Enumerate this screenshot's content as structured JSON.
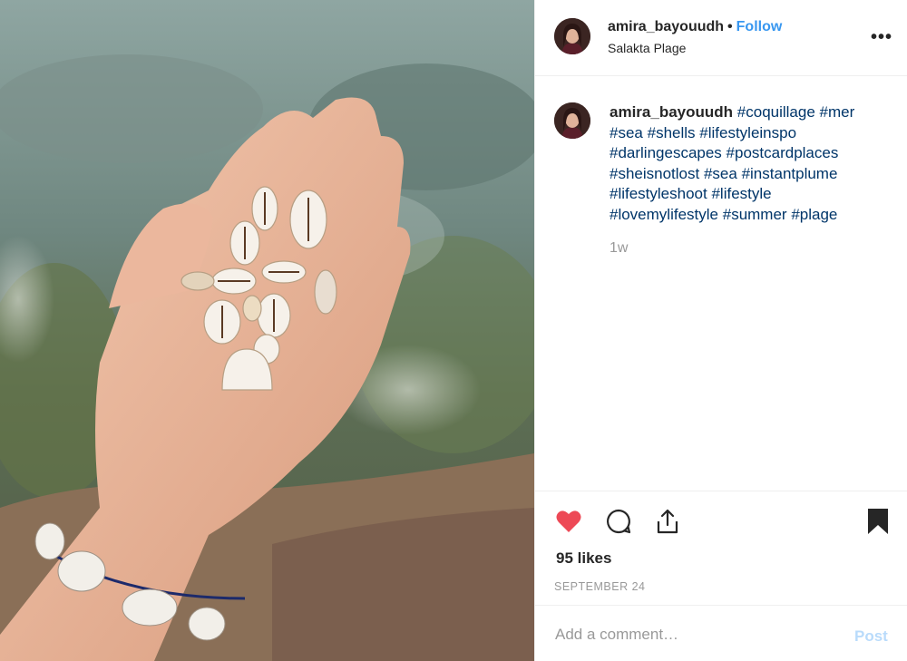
{
  "post": {
    "username": "amira_bayouudh",
    "follow_label": "Follow",
    "separator": "•",
    "location": "Salakta Plage",
    "more_label": "•••",
    "caption_username": "amira_bayouudh",
    "hashtags": [
      "#coquillage",
      "#mer",
      "#sea",
      "#shells",
      "#lifestyleinspo",
      "#darlingescapes",
      "#postcardplaces",
      "#sheisnotlost",
      "#sea",
      "#instantplume",
      "#lifestyleshoot",
      "#lifestyle",
      "#lovemylifestyle",
      "#summer",
      "#plage"
    ],
    "time_ago": "1w",
    "likes": "95 likes",
    "date": "SEPTEMBER 24",
    "comment_placeholder": "Add a comment…",
    "post_label": "Post"
  },
  "colors": {
    "link_blue": "#3897f0",
    "hashtag_blue": "#003569",
    "heart_red": "#ed4956",
    "post_disabled": "#b9dbfb",
    "muted_gray": "#999999"
  },
  "icons": {
    "like": "heart-filled-icon",
    "comment": "comment-bubble-icon",
    "share": "share-upload-icon",
    "save": "bookmark-filled-icon",
    "more": "more-options-icon"
  }
}
